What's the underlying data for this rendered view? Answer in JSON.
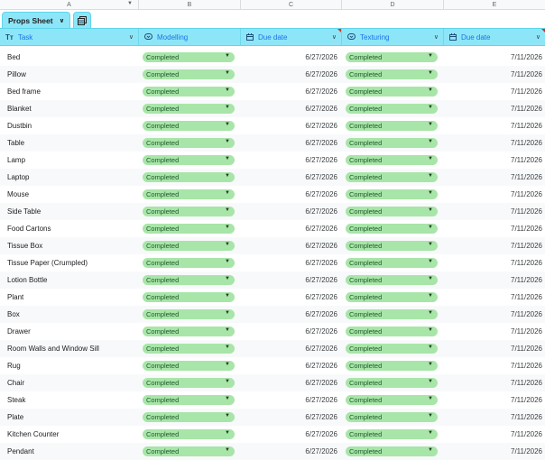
{
  "columns": {
    "letters": [
      "A",
      "B",
      "C",
      "D",
      "E"
    ]
  },
  "table": {
    "name": "Props Sheet"
  },
  "headers": {
    "task": "Task",
    "modelling": "Modelling",
    "due_date_1": "Due date",
    "texturing": "Texturing",
    "due_date_2": "Due date"
  },
  "rows": [
    {
      "task": "Bed",
      "modelling": "Completed",
      "due1": "6/27/2026",
      "texturing": "Completed",
      "due2": "7/11/2026"
    },
    {
      "task": "Pillow",
      "modelling": "Completed",
      "due1": "6/27/2026",
      "texturing": "Completed",
      "due2": "7/11/2026"
    },
    {
      "task": "Bed frame",
      "modelling": "Completed",
      "due1": "6/27/2026",
      "texturing": "Completed",
      "due2": "7/11/2026"
    },
    {
      "task": "Blanket",
      "modelling": "Completed",
      "due1": "6/27/2026",
      "texturing": "Completed",
      "due2": "7/11/2026"
    },
    {
      "task": "Dustbin",
      "modelling": "Completed",
      "due1": "6/27/2026",
      "texturing": "Completed",
      "due2": "7/11/2026"
    },
    {
      "task": "Table",
      "modelling": "Completed",
      "due1": "6/27/2026",
      "texturing": "Completed",
      "due2": "7/11/2026"
    },
    {
      "task": "Lamp",
      "modelling": "Completed",
      "due1": "6/27/2026",
      "texturing": "Completed",
      "due2": "7/11/2026"
    },
    {
      "task": "Laptop",
      "modelling": "Completed",
      "due1": "6/27/2026",
      "texturing": "Completed",
      "due2": "7/11/2026"
    },
    {
      "task": "Mouse",
      "modelling": "Completed",
      "due1": "6/27/2026",
      "texturing": "Completed",
      "due2": "7/11/2026"
    },
    {
      "task": "Side Table",
      "modelling": "Completed",
      "due1": "6/27/2026",
      "texturing": "Completed",
      "due2": "7/11/2026"
    },
    {
      "task": "Food Cartons",
      "modelling": "Completed",
      "due1": "6/27/2026",
      "texturing": "Completed",
      "due2": "7/11/2026"
    },
    {
      "task": "Tissue Box",
      "modelling": "Completed",
      "due1": "6/27/2026",
      "texturing": "Completed",
      "due2": "7/11/2026"
    },
    {
      "task": "Tissue Paper (Crumpled)",
      "modelling": "Completed",
      "due1": "6/27/2026",
      "texturing": "Completed",
      "due2": "7/11/2026"
    },
    {
      "task": "Lotion Bottle",
      "modelling": "Completed",
      "due1": "6/27/2026",
      "texturing": "Completed",
      "due2": "7/11/2026"
    },
    {
      "task": "Plant",
      "modelling": "Completed",
      "due1": "6/27/2026",
      "texturing": "Completed",
      "due2": "7/11/2026"
    },
    {
      "task": "Box",
      "modelling": "Completed",
      "due1": "6/27/2026",
      "texturing": "Completed",
      "due2": "7/11/2026"
    },
    {
      "task": "Drawer",
      "modelling": "Completed",
      "due1": "6/27/2026",
      "texturing": "Completed",
      "due2": "7/11/2026"
    },
    {
      "task": "Room Walls and Window Sill",
      "modelling": "Completed",
      "due1": "6/27/2026",
      "texturing": "Completed",
      "due2": "7/11/2026"
    },
    {
      "task": "Rug",
      "modelling": "Completed",
      "due1": "6/27/2026",
      "texturing": "Completed",
      "due2": "7/11/2026"
    },
    {
      "task": "Chair",
      "modelling": "Completed",
      "due1": "6/27/2026",
      "texturing": "Completed",
      "due2": "7/11/2026"
    },
    {
      "task": "Steak",
      "modelling": "Completed",
      "due1": "6/27/2026",
      "texturing": "Completed",
      "due2": "7/11/2026"
    },
    {
      "task": "Plate",
      "modelling": "Completed",
      "due1": "6/27/2026",
      "texturing": "Completed",
      "due2": "7/11/2026"
    },
    {
      "task": "Kitchen Counter",
      "modelling": "Completed",
      "due1": "6/27/2026",
      "texturing": "Completed",
      "due2": "7/11/2026"
    },
    {
      "task": "Pendant",
      "modelling": "Completed",
      "due1": "6/27/2026",
      "texturing": "Completed",
      "due2": "7/11/2026"
    }
  ],
  "icons": {
    "task_header": "text-type-icon",
    "status_header": "dropdown-chip-icon",
    "date_header": "calendar-icon",
    "table_view": "table-view-icon"
  },
  "colors": {
    "header_bg": "#8de6f7",
    "chip_bg": "#a8e5a8",
    "header_text": "#1a73e8",
    "note_marker": "#d93025"
  }
}
